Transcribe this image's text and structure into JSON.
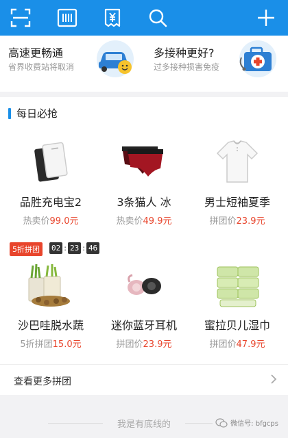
{
  "toolbar": {
    "icons": [
      "scan-icon",
      "barcode-icon",
      "invoice-icon",
      "search-icon",
      "add-icon"
    ],
    "accent": "#1a8fe8"
  },
  "promos": [
    {
      "title": "高速更畅通",
      "subtitle": "省界收费站将取消",
      "icon": "car-icon"
    },
    {
      "title": "多接种更好?",
      "subtitle": "过多接种损害免疫",
      "icon": "medical-kit-icon"
    }
  ],
  "daily": {
    "title": "每日必抢",
    "row1": [
      {
        "name": "品胜充电宝2",
        "price_label": "热卖价",
        "price": "99.0元",
        "icon": "power-bank-icon"
      },
      {
        "name": "3条猫人 冰",
        "price_label": "热卖价",
        "price": "49.9元",
        "icon": "underwear-icon"
      },
      {
        "name": "男士短袖夏季",
        "price_label": "拼团价",
        "price": "23.9元",
        "icon": "tshirt-icon"
      }
    ],
    "deal_badge": "5折拼团",
    "timer": {
      "h": "02",
      "m": "23",
      "s": "46"
    },
    "row2": [
      {
        "name": "沙巴哇脱水蔬",
        "price_label": "5折拼团",
        "price": "15.0元",
        "icon": "dried-veg-icon"
      },
      {
        "name": "迷你蓝牙耳机",
        "price_label": "拼团价",
        "price": "23.9元",
        "icon": "earphone-icon"
      },
      {
        "name": "蜜拉贝儿湿巾",
        "price_label": "拼团价",
        "price": "47.9元",
        "icon": "wet-wipes-icon"
      }
    ],
    "more_label": "查看更多拼团"
  },
  "footer": {
    "bottom_text": "我是有底线的",
    "watermark": "微信号: bfgcps"
  },
  "colors": {
    "price": "#e8452c",
    "badge": "#e8452c"
  }
}
